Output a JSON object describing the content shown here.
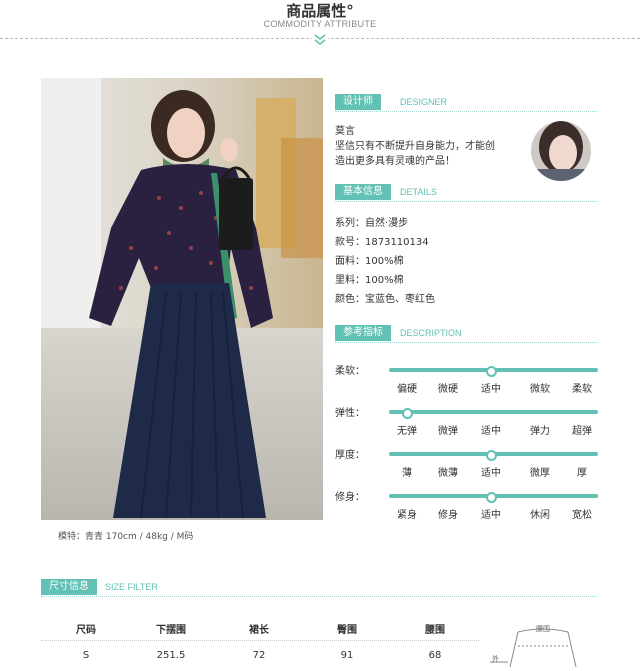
{
  "header": {
    "title": "商品属性°",
    "subtitle": "COMMODITY ATTRIBUTE"
  },
  "photo": {
    "caption": "模特：青青   170cm / 48kg / M码"
  },
  "designer": {
    "tag": "设计师",
    "tag_en": "DESIGNER",
    "name": "莫言",
    "bio_line1": "坚信只有不断提升自身能力，才能创",
    "bio_line2": "造出更多具有灵魂的产品！"
  },
  "details": {
    "tag": "基本信息",
    "tag_en": "DETAILS",
    "rows": [
      "系列：自然·漫步",
      "款号：1873110134",
      "面料：100%棉",
      "里料：100%棉",
      "颜色：宝蓝色、枣红色"
    ]
  },
  "reference": {
    "tag": "参考指标",
    "tag_en": "DESCRIPTION",
    "sliders": [
      {
        "label": "柔软：",
        "options": [
          "偏硬",
          "微硬",
          "适中",
          "微软",
          "柔软"
        ],
        "value_index": 2
      },
      {
        "label": "弹性：",
        "options": [
          "无弹",
          "微弹",
          "适中",
          "弹力",
          "超弹"
        ],
        "value_index": 0
      },
      {
        "label": "厚度：",
        "options": [
          "薄",
          "微薄",
          "适中",
          "微厚",
          "厚"
        ],
        "value_index": 2
      },
      {
        "label": "修身：",
        "options": [
          "紧身",
          "修身",
          "适中",
          "休闲",
          "宽松"
        ],
        "value_index": 2
      }
    ]
  },
  "size": {
    "tag": "尺寸信息",
    "tag_en": "SIZE FILTER",
    "columns": [
      "尺码",
      "下摆围",
      "裙长",
      "臀围",
      "腰围"
    ],
    "rows": [
      [
        "S",
        "251.5",
        "72",
        "91",
        "68"
      ]
    ],
    "diagram_labels": [
      "腰围",
      "外"
    ]
  },
  "colors": {
    "accent": "#62c0b4",
    "skirt": "#1e2a48",
    "blouse": "#2a2140"
  }
}
